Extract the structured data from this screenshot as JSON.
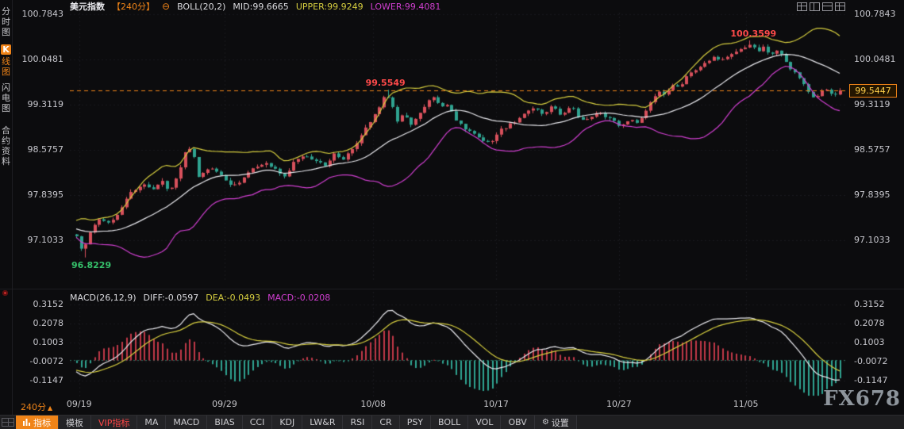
{
  "app": {
    "watermark": "FX678"
  },
  "icons": {
    "collapse": "⊖",
    "gear": "⚙",
    "arrow_up": "▲"
  },
  "sidebar": {
    "items": [
      {
        "key": "time-chart",
        "label": "分时图",
        "active": false
      },
      {
        "key": "kline-chart",
        "label": "K线图",
        "active": true
      },
      {
        "key": "lightning-chart",
        "label": "闪电图",
        "active": false
      },
      {
        "key": "contract-info",
        "label": "合约资料",
        "active": false
      }
    ]
  },
  "topbar": {
    "symbol": "美元指数",
    "period": "【240分】",
    "indicator": "BOLL(20,2)",
    "mid": "MID:99.6665",
    "upper": "UPPER:99.9249",
    "lower": "LOWER:99.4081"
  },
  "period_selector": {
    "label": "240分"
  },
  "toolbar": {
    "primary_tab": {
      "key": "indicators",
      "label": "指标"
    },
    "tabs": [
      {
        "key": "template",
        "label": "模板"
      },
      {
        "key": "vip-indicators",
        "label": "VIP指标",
        "accent": "red"
      },
      {
        "key": "ma",
        "label": "MA"
      },
      {
        "key": "macd",
        "label": "MACD"
      },
      {
        "key": "bias",
        "label": "BIAS"
      },
      {
        "key": "cci",
        "label": "CCI"
      },
      {
        "key": "kdj",
        "label": "KDJ"
      },
      {
        "key": "lwr",
        "label": "LW&R"
      },
      {
        "key": "rsi",
        "label": "RSI"
      },
      {
        "key": "cr",
        "label": "CR"
      },
      {
        "key": "psy",
        "label": "PSY"
      },
      {
        "key": "boll",
        "label": "BOLL"
      },
      {
        "key": "vol",
        "label": "VOL"
      },
      {
        "key": "obv",
        "label": "OBV"
      },
      {
        "key": "settings",
        "label": "设置"
      }
    ]
  },
  "chart_data": {
    "type": "candlestick",
    "symbol": "美元指数",
    "interval": "240分",
    "indicator_overlay": "BOLL(20,2)",
    "boll": {
      "mid": 99.6665,
      "upper": 99.9249,
      "lower": 99.4081
    },
    "last_price": 99.5447,
    "price_axis_labels": [
      "100.7843",
      "100.0481",
      "99.3119",
      "98.5757",
      "97.8395",
      "97.1033"
    ],
    "x_dates": [
      {
        "label": "09/19",
        "frac": 0.012
      },
      {
        "label": "09/29",
        "frac": 0.199
      },
      {
        "label": "10/08",
        "frac": 0.39
      },
      {
        "label": "10/17",
        "frac": 0.548
      },
      {
        "label": "10/27",
        "frac": 0.706
      },
      {
        "label": "11/05",
        "frac": 0.869
      }
    ],
    "marked_low": {
      "frac": 0.012,
      "price": 96.8229
    },
    "marked_high_1": {
      "frac": 0.406,
      "price": 99.5549
    },
    "marked_high_2": {
      "frac": 0.884,
      "price": 100.3599
    },
    "candle_count": 170,
    "close_path": [
      [
        0.0,
        97.18
      ],
      [
        0.006,
        96.98
      ],
      [
        0.012,
        97.06
      ],
      [
        0.02,
        97.32
      ],
      [
        0.032,
        97.45
      ],
      [
        0.045,
        97.38
      ],
      [
        0.058,
        97.62
      ],
      [
        0.072,
        97.88
      ],
      [
        0.085,
        98.02
      ],
      [
        0.1,
        97.95
      ],
      [
        0.112,
        98.06
      ],
      [
        0.122,
        97.9
      ],
      [
        0.132,
        98.15
      ],
      [
        0.145,
        98.68
      ],
      [
        0.152,
        98.55
      ],
      [
        0.16,
        98.15
      ],
      [
        0.172,
        98.28
      ],
      [
        0.185,
        98.22
      ],
      [
        0.2,
        98.02
      ],
      [
        0.21,
        97.98
      ],
      [
        0.222,
        98.16
      ],
      [
        0.235,
        98.28
      ],
      [
        0.248,
        98.38
      ],
      [
        0.26,
        98.26
      ],
      [
        0.272,
        98.15
      ],
      [
        0.285,
        98.38
      ],
      [
        0.298,
        98.5
      ],
      [
        0.312,
        98.4
      ],
      [
        0.325,
        98.32
      ],
      [
        0.338,
        98.52
      ],
      [
        0.35,
        98.42
      ],
      [
        0.363,
        98.62
      ],
      [
        0.375,
        98.85
      ],
      [
        0.388,
        99.1
      ],
      [
        0.398,
        99.32
      ],
      [
        0.406,
        99.5
      ],
      [
        0.414,
        99.28
      ],
      [
        0.421,
        99.02
      ],
      [
        0.429,
        99.18
      ],
      [
        0.436,
        98.95
      ],
      [
        0.446,
        99.15
      ],
      [
        0.456,
        99.32
      ],
      [
        0.466,
        99.42
      ],
      [
        0.477,
        99.28
      ],
      [
        0.487,
        99.35
      ],
      [
        0.497,
        99.08
      ],
      [
        0.508,
        98.92
      ],
      [
        0.52,
        98.82
      ],
      [
        0.532,
        98.7
      ],
      [
        0.543,
        98.66
      ],
      [
        0.556,
        98.88
      ],
      [
        0.57,
        99.0
      ],
      [
        0.583,
        99.12
      ],
      [
        0.597,
        99.26
      ],
      [
        0.61,
        99.16
      ],
      [
        0.623,
        99.28
      ],
      [
        0.636,
        99.1
      ],
      [
        0.648,
        99.28
      ],
      [
        0.66,
        99.02
      ],
      [
        0.672,
        99.12
      ],
      [
        0.685,
        99.18
      ],
      [
        0.698,
        99.1
      ],
      [
        0.71,
        98.96
      ],
      [
        0.722,
        99.06
      ],
      [
        0.734,
        99.02
      ],
      [
        0.745,
        99.2
      ],
      [
        0.755,
        99.4
      ],
      [
        0.763,
        99.55
      ],
      [
        0.771,
        99.45
      ],
      [
        0.78,
        99.62
      ],
      [
        0.79,
        99.58
      ],
      [
        0.8,
        99.78
      ],
      [
        0.812,
        99.88
      ],
      [
        0.824,
        99.98
      ],
      [
        0.836,
        100.08
      ],
      [
        0.848,
        100.02
      ],
      [
        0.86,
        100.14
      ],
      [
        0.872,
        100.24
      ],
      [
        0.884,
        100.32
      ],
      [
        0.892,
        100.18
      ],
      [
        0.9,
        100.26
      ],
      [
        0.908,
        100.08
      ],
      [
        0.918,
        100.2
      ],
      [
        0.928,
        100.02
      ],
      [
        0.938,
        99.86
      ],
      [
        0.948,
        99.72
      ],
      [
        0.958,
        99.55
      ],
      [
        0.968,
        99.42
      ],
      [
        0.978,
        99.6
      ],
      [
        0.99,
        99.5
      ],
      [
        1.0,
        99.5447
      ]
    ],
    "macd": {
      "title": "MACD(26,12,9)",
      "diff_label": "DIFF:-0.0597",
      "dea_label": "DEA:-0.0493",
      "macd_label": "MACD:-0.0208",
      "diff": -0.0597,
      "dea": -0.0493,
      "macd": -0.0208,
      "axis_labels": [
        "0.3152",
        "0.2078",
        "0.1003",
        "-0.0072",
        "-0.1147"
      ]
    },
    "colors": {
      "up": "#d8505c",
      "down": "#2fa390",
      "boll_upper": "#d6ce3f",
      "boll_mid": "#e9e9ee",
      "boll_lower": "#d03fd0",
      "last_price_line": "#f08418",
      "hist_up": "#c03848",
      "hist_down": "#2fa390",
      "diff_line": "#e9e9ee",
      "dea_line": "#d6ce3f",
      "accent_orange": "#f08418",
      "annotation_red": "#ff4a4a",
      "annotation_green": "#35c06a"
    }
  }
}
